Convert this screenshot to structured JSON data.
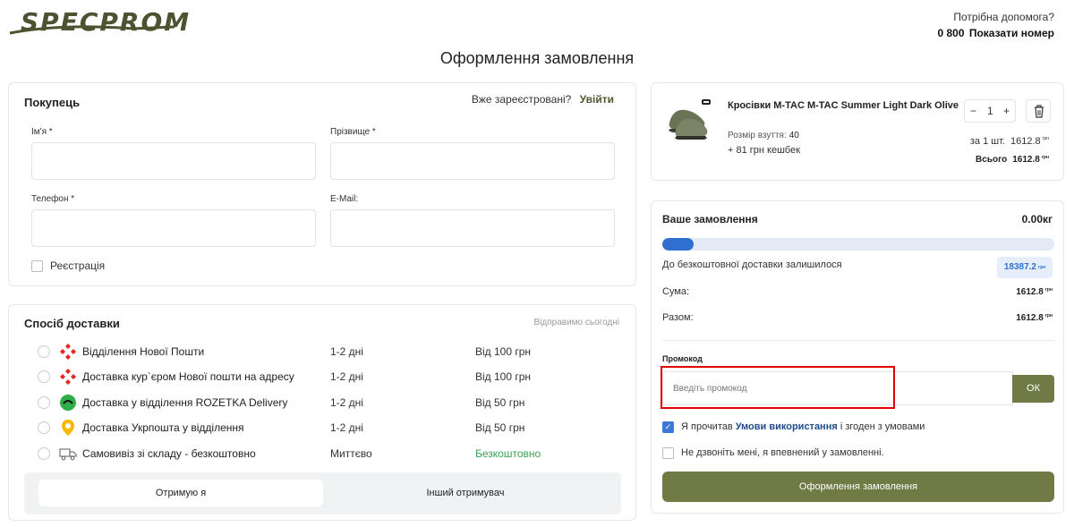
{
  "header": {
    "logo_text": "SPECPROM",
    "help_question": "Потрібна допомога?",
    "phone_number": "0 800",
    "show_number": "Показати номер"
  },
  "page_title": "Оформлення замовлення",
  "buyer": {
    "title": "Покупець",
    "registered_question": "Вже зареєстровані?",
    "login_link": "Увійти",
    "first_name_label": "Ім'я *",
    "last_name_label": "Прізвище *",
    "phone_label": "Телефон *",
    "email_label": "E-Mail:",
    "register_label": "Реєстрація"
  },
  "delivery": {
    "title": "Спосіб доставки",
    "ship_today": "Відправимо сьогодні",
    "options": [
      {
        "name": "Відділення Нової Пошти",
        "time": "1-2 дні",
        "price": "Від 100 грн",
        "icon": "nova-poshta-icon"
      },
      {
        "name": "Доставка кур`єром Нової пошти на адресу",
        "time": "1-2 дні",
        "price": "Від 100 грн",
        "icon": "nova-poshta-icon"
      },
      {
        "name": "Доставка у відділення ROZETKA Delivery",
        "time": "1-2 дні",
        "price": "Від 50 грн",
        "icon": "rozetka-icon"
      },
      {
        "name": "Доставка Укрпошта у відділення",
        "time": "1-2 дні",
        "price": "Від 50 грн",
        "icon": "ukrposhta-icon"
      },
      {
        "name": "Самовивіз зі складу - безкоштовно",
        "time": "Миттєво",
        "price": "Безкоштовно",
        "icon": "truck-icon"
      }
    ],
    "receiver_me": "Отримую я",
    "receiver_other": "Інший отримувач"
  },
  "product": {
    "name": "Кросівки M-TAC M-TAC Summer Light Dark Olive",
    "size_label": "Розмір взуття:",
    "size_value": "40",
    "cashback": "+ 81 грн кешбек",
    "quantity": "1",
    "per_unit_label": "за 1 шт.",
    "per_unit_price": "1612.8",
    "total_label": "Всього",
    "total_price": "1612.8",
    "currency": "грн"
  },
  "order": {
    "title": "Ваше замовлення",
    "weight": "0.00кг",
    "progress_fraction": 0.08,
    "free_delivery_label": "До безкоштовної доставки залишилося",
    "free_delivery_remaining": "18387.2",
    "sum_label": "Сума:",
    "sum_value": "1612.8",
    "total_label": "Разом:",
    "total_value": "1612.8",
    "promo_title": "Промокод",
    "promo_placeholder": "Введіть промокод",
    "ok_label": "ОК",
    "terms_prefix": "Я прочитав",
    "terms_link": "Умови використання",
    "terms_suffix": "і згоден з умовами",
    "no_call_label": "Не дзвоніть мені, я впевнений у замовленні.",
    "submit_label": "Оформлення замовлення"
  },
  "colors": {
    "brand_olive": "#6f7a45",
    "accent_blue": "#2f6fcf",
    "free_green": "#3aa352",
    "highlight_red": "#e00000"
  }
}
